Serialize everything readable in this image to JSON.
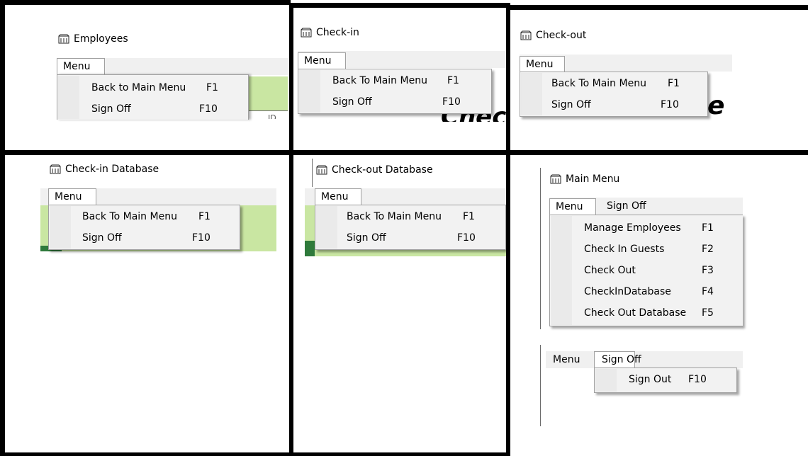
{
  "panels": {
    "employees": {
      "title": "Employees",
      "menu_label": "Menu",
      "items": [
        {
          "label": "Back to Main Menu",
          "key": "F1"
        },
        {
          "label": "Sign Off",
          "key": "F10"
        }
      ],
      "partial_text": "ID"
    },
    "checkin": {
      "title": "Check-in",
      "menu_label": "Menu",
      "items": [
        {
          "label": "Back To Main Menu",
          "key": "F1"
        },
        {
          "label": "Sign Off",
          "key": "F10"
        }
      ],
      "partial_text": "Chec"
    },
    "checkout": {
      "title": "Check-out",
      "menu_label": "Menu",
      "items": [
        {
          "label": "Back To Main Menu",
          "key": "F1"
        },
        {
          "label": "Sign Off",
          "key": "F10"
        }
      ],
      "partial_text": "e"
    },
    "checkin_db": {
      "title": "Check-in Database",
      "menu_label": "Menu",
      "items": [
        {
          "label": "Back To Main Menu",
          "key": "F1"
        },
        {
          "label": "Sign Off",
          "key": "F10"
        }
      ]
    },
    "checkout_db": {
      "title": "Check-out Database",
      "menu_label": "Menu",
      "items": [
        {
          "label": "Back To Main Menu",
          "key": "F1"
        },
        {
          "label": "Sign Off",
          "key": "F10"
        }
      ]
    },
    "main_menu": {
      "title": "Main Menu",
      "menu_label": "Menu",
      "signoff_label": "Sign Off",
      "items": [
        {
          "label": "Manage Employees",
          "key": "F1"
        },
        {
          "label": "Check In Guests",
          "key": "F2"
        },
        {
          "label": "Check Out",
          "key": "F3"
        },
        {
          "label": "CheckInDatabase",
          "key": "F4"
        },
        {
          "label": "Check Out Database",
          "key": "F5"
        }
      ]
    },
    "signoff_menu": {
      "menu_label": "Menu",
      "signoff_label": "Sign Off",
      "items": [
        {
          "label": "Sign Out",
          "key": "F10"
        }
      ]
    }
  },
  "icons": {
    "window_icon": "window-app-icon"
  }
}
